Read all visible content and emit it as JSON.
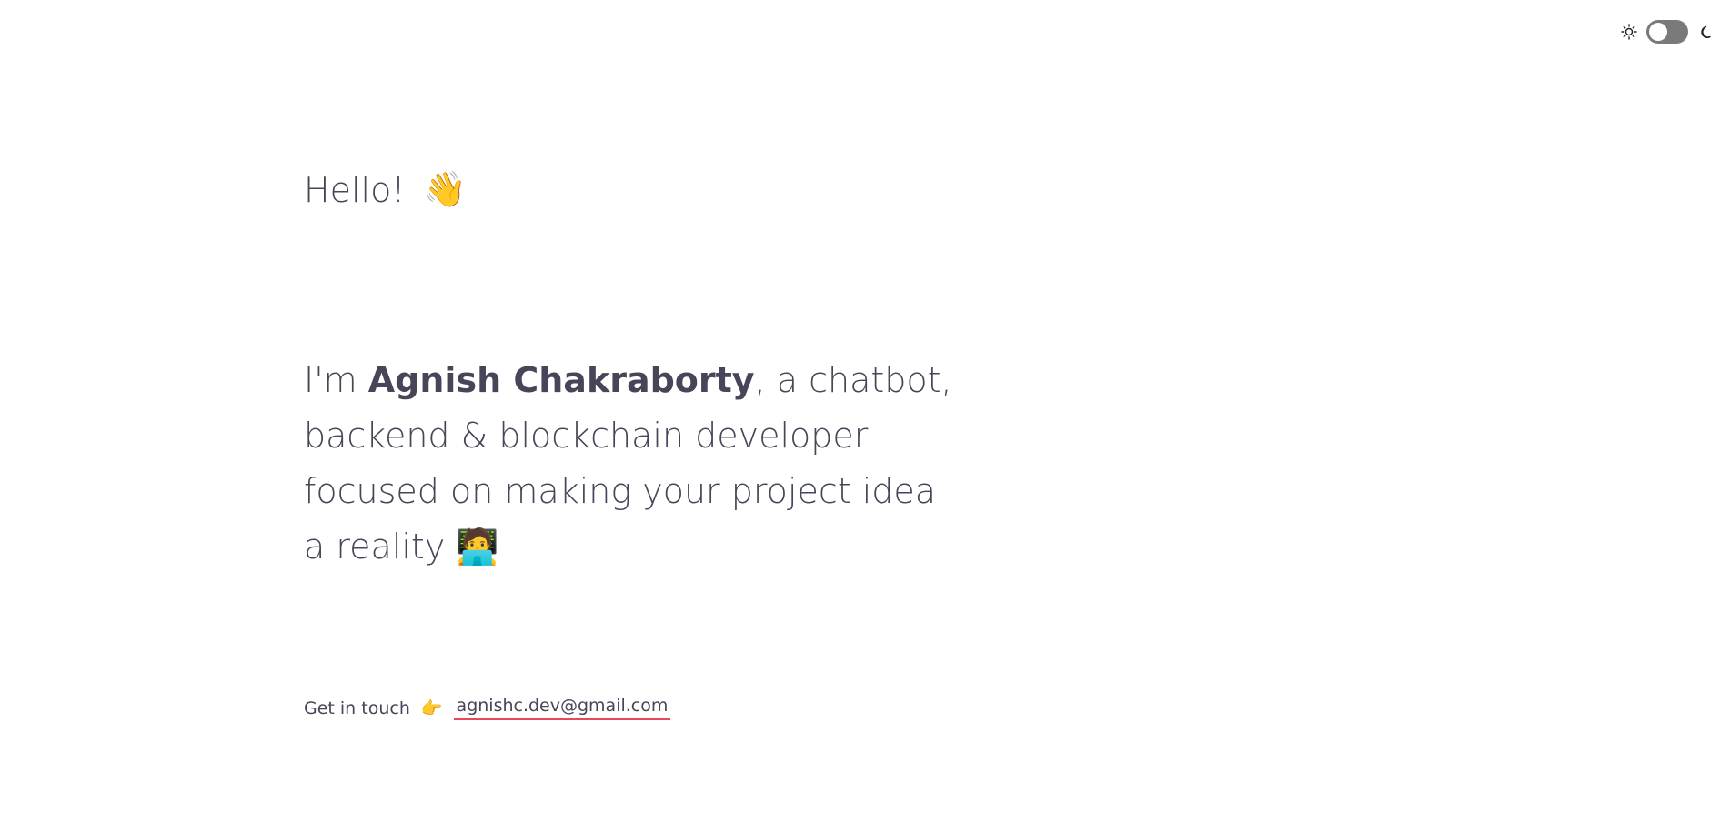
{
  "theme_toggle": {
    "light_icon": "sun-icon",
    "dark_icon": "moon-icon",
    "state": "light"
  },
  "hero": {
    "greeting": "Hello!",
    "greeting_emoji": "👋",
    "intro_prefix": "I'm",
    "name": "Agnish Chakraborty",
    "intro_suffix": ", a chatbot, backend & blockchain developer focused on making your project idea a reality",
    "intro_emoji": "🧑‍💻"
  },
  "contact": {
    "label": "Get in touch",
    "pointer_emoji": "👉",
    "email": "agnishc.dev@gmail.com"
  },
  "colors": {
    "text": "#4a4458",
    "underline_accent": "#e8485c",
    "toggle_track": "#7a7a7a"
  }
}
